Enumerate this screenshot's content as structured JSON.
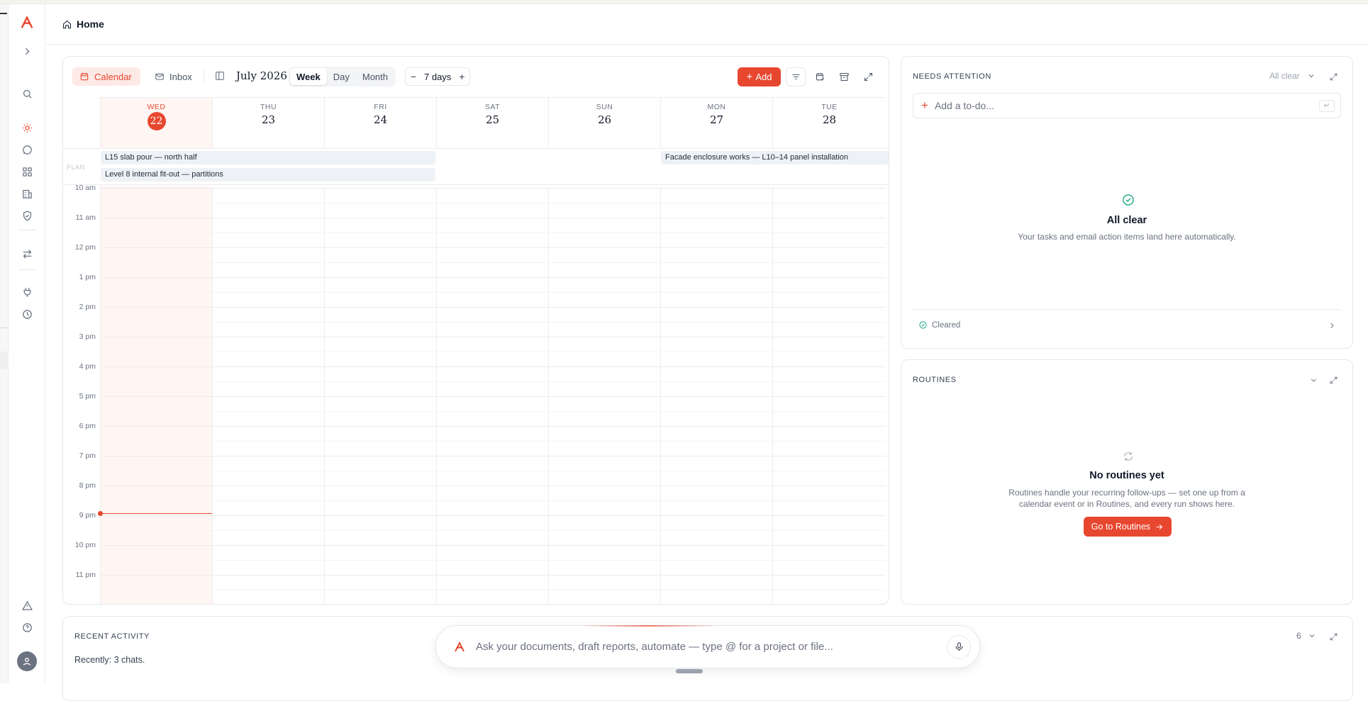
{
  "header": {
    "title": "Home"
  },
  "sidebar": {
    "items": [
      {
        "icon": "search-icon"
      },
      {
        "icon": "sun-icon",
        "active": true
      },
      {
        "icon": "chat-icon"
      },
      {
        "icon": "grid-icon"
      },
      {
        "icon": "building-icon"
      },
      {
        "icon": "shield-check-icon"
      },
      {
        "icon": "arrows-swap-icon"
      },
      {
        "icon": "plug-icon"
      },
      {
        "icon": "clock-icon"
      },
      {
        "icon": "warning-icon"
      },
      {
        "icon": "help-icon"
      }
    ]
  },
  "calendar": {
    "tabs": {
      "calendar": "Calendar",
      "inbox": "Inbox"
    },
    "month": "July 2026",
    "views": [
      "Week",
      "Day",
      "Month"
    ],
    "active_view": "Week",
    "range": "7 days",
    "range_minus": "−",
    "range_plus": "+",
    "add_label": "Add",
    "days": [
      {
        "name": "WED",
        "date": "22",
        "today": true
      },
      {
        "name": "THU",
        "date": "23"
      },
      {
        "name": "FRI",
        "date": "24"
      },
      {
        "name": "SAT",
        "date": "25"
      },
      {
        "name": "SUN",
        "date": "26"
      },
      {
        "name": "MON",
        "date": "27"
      },
      {
        "name": "TUE",
        "date": "28"
      }
    ],
    "plan_label": "PLAN",
    "events": [
      {
        "title": "L15 slab pour — north half"
      },
      {
        "title": "Level 8 internal fit-out — partitions"
      },
      {
        "title": "Facade enclosure works — L10–14 panel installation"
      }
    ],
    "hours": [
      "10 am",
      "11 am",
      "12 pm",
      "1 pm",
      "2 pm",
      "3 pm",
      "4 pm",
      "5 pm",
      "6 pm",
      "7 pm",
      "8 pm",
      "9 pm",
      "10 pm",
      "11 pm"
    ]
  },
  "needs_attention": {
    "title": "NEEDS ATTENTION",
    "filter": "All clear",
    "todo_placeholder": "Add a to-do...",
    "enter_key": "↵",
    "empty_title": "All clear",
    "empty_text": "Your tasks and email action items land here automatically.",
    "cleared_label": "Cleared"
  },
  "routines": {
    "title": "ROUTINES",
    "empty_title": "No routines yet",
    "empty_text_1": "Routines handle your recurring follow-ups — set one up from a",
    "empty_text_2": "calendar event or in Routines, and every run shows here.",
    "cta": "Go to Routines"
  },
  "recent": {
    "title": "RECENT ACTIVITY",
    "summary": "Recently: 3 chats.",
    "count": "6"
  },
  "chat": {
    "placeholder": "Ask your documents, draft reports, automate — type @ for a project or file..."
  },
  "colors": {
    "accent": "#e8472f",
    "success": "#14a37f"
  }
}
